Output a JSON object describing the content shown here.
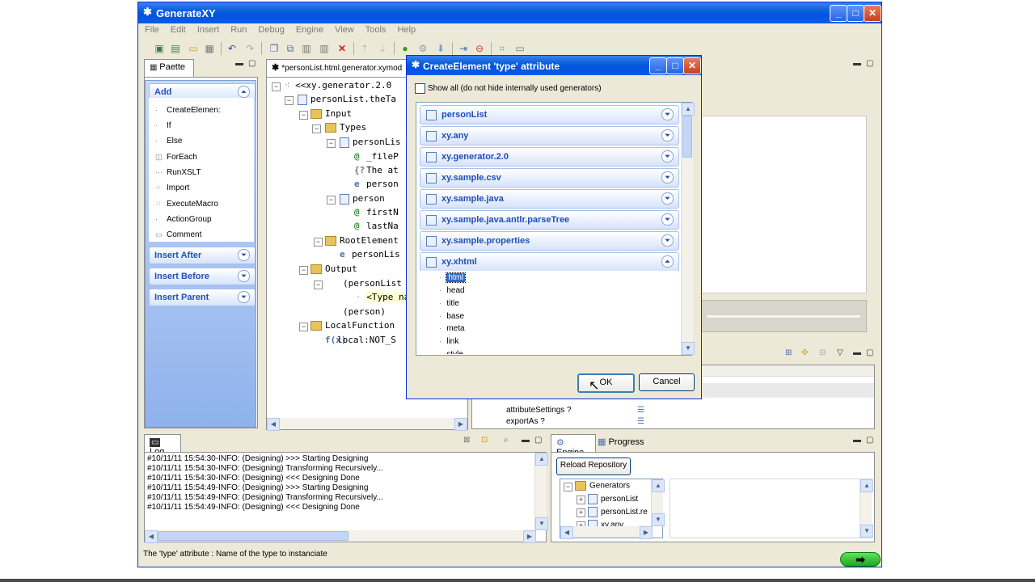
{
  "window": {
    "title": "GenerateXY"
  },
  "menu": [
    "File",
    "Edit",
    "Insert",
    "Run",
    "Debug",
    "Engine",
    "View",
    "Tools",
    "Help"
  ],
  "palette": {
    "tab": "Paette",
    "groups": {
      "add": "Add",
      "insert_after": "Insert After",
      "insert_before": "Insert Before",
      "insert_parent": "Insert Parent"
    },
    "items": [
      "CreateElemen:",
      "If",
      "Else",
      "ForEach",
      "RunXSLT",
      "Import",
      "ExecuteMacro",
      "ActionGroup",
      "Comment"
    ]
  },
  "editor": {
    "tab": "*personList.html.generator.xymod",
    "tree": [
      "<<xy.generator.2.0",
      "personList.theTa",
      "Input",
      "Types",
      "personLis",
      "_fileP",
      "The at",
      "person",
      "person",
      "firstN",
      "lastNa",
      "RootElement",
      "personLis",
      "Output",
      "(personList",
      "<Type nam",
      "(person)",
      "LocalFunction",
      "local:NOT_S"
    ]
  },
  "dialog": {
    "title": "CreateElement 'type' attribute",
    "show_all": "Show all (do not hide internally used generators)",
    "groups": [
      "personList",
      "xy.any",
      "xy.generator.2.0",
      "xy.sample.csv",
      "xy.sample.java",
      "xy.sample.java.antlr.parseTree",
      "xy.sample.properties",
      "xy.xhtml"
    ],
    "xhtml_items": [
      "html",
      "head",
      "title",
      "base",
      "meta",
      "link",
      "style"
    ],
    "ok": "OK",
    "cancel": "Cancel"
  },
  "props": {
    "rows": [
      "attributeSettings ?",
      "exportAs ?"
    ]
  },
  "log": {
    "tab": "Log",
    "lines": [
      "#10/11/11 15:54:30-INFO: (Designing) >>> Starting Designing",
      "#10/11/11 15:54:30-INFO: (Designing) Transforming Recursively...",
      "#10/11/11 15:54:30-INFO: (Designing) <<< Designing Done",
      "#10/11/11 15:54:49-INFO: (Designing) >>> Starting Designing",
      "#10/11/11 15:54:49-INFO: (Designing) Transforming Recursively...",
      "#10/11/11 15:54:49-INFO: (Designing) <<< Designing Done"
    ]
  },
  "engine": {
    "tab_engine": "Engine",
    "tab_progress": "Progress",
    "reload": "Reload Repository",
    "tree": [
      "Generators",
      "personList",
      "personList.re",
      "xy.any"
    ]
  },
  "status": {
    "text": "The 'type' attribute : Name of the type to instanciate"
  }
}
